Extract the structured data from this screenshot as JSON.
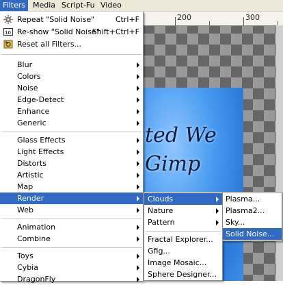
{
  "menubar": {
    "items": [
      "Filters",
      "Media",
      "Script-Fu",
      "Video"
    ]
  },
  "ruler": {
    "labels": [
      "200",
      "300"
    ]
  },
  "image_text": {
    "line1": "ted We",
    "line2": "Gimp"
  },
  "filters_menu": {
    "top_items": [
      {
        "label": "Repeat \"Solid Noise\"",
        "shortcut": "Ctrl+F",
        "icon": "repeat-icon"
      },
      {
        "label": "Re-show \"Solid Noise\"",
        "shortcut": "Shift+Ctrl+F",
        "icon": "reshow-icon"
      },
      {
        "label": "Reset all Filters...",
        "icon": "reset-icon"
      }
    ],
    "group1": [
      "Blur",
      "Colors",
      "Noise",
      "Edge-Detect",
      "Enhance",
      "Generic"
    ],
    "group2": [
      "Glass Effects",
      "Light Effects",
      "Distorts",
      "Artistic",
      "Map",
      "Render",
      "Web"
    ],
    "group3": [
      "Animation",
      "Combine"
    ],
    "group4": [
      "Toys",
      "Cybia",
      "DragonFly"
    ]
  },
  "render_menu": {
    "items": [
      "Clouds",
      "Nature",
      "Pattern"
    ],
    "items2": [
      "Fractal Explorer...",
      "Gfig...",
      "Image Mosaic...",
      "Sphere Designer..."
    ]
  },
  "clouds_menu": {
    "items": [
      "Plasma...",
      "Plasma2...",
      "Sky...",
      "Solid Noise..."
    ]
  },
  "colors": {
    "highlight": "#316ac5",
    "menubar_bg": "#ece9d8"
  }
}
